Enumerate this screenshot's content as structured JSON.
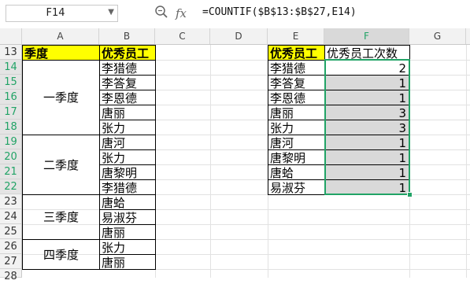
{
  "formula_bar": {
    "name_box": "F14",
    "zoom_icon": "zoom-icon",
    "fx_label": "fx",
    "formula": "=COUNTIF($B$13:$B$27,E14)"
  },
  "columns": [
    "A",
    "B",
    "C",
    "D",
    "E",
    "F",
    "G"
  ],
  "rows": [
    "13",
    "14",
    "15",
    "16",
    "17",
    "18",
    "19",
    "20",
    "21",
    "22",
    "23",
    "24",
    "25",
    "26",
    "27",
    "28"
  ],
  "table_left": {
    "header_quarter": "季度",
    "header_employee": "优秀员工",
    "quarters": [
      "一季度",
      "二季度",
      "三季度",
      "四季度"
    ],
    "employees": [
      "李猎德",
      "李答复",
      "李恩德",
      "唐丽",
      "张力",
      "唐河",
      "张力",
      "唐黎明",
      "李猎德",
      "唐蛤",
      "易淑芬",
      "唐丽",
      "张力",
      "唐丽"
    ]
  },
  "table_right": {
    "header_employee": "优秀员工",
    "header_count": "优秀员工次数",
    "names": [
      "李猎德",
      "李答复",
      "李恩德",
      "唐丽",
      "张力",
      "唐河",
      "唐黎明",
      "唐蛤",
      "易淑芬"
    ],
    "counts": [
      "2",
      "1",
      "1",
      "3",
      "3",
      "1",
      "1",
      "1",
      "1"
    ]
  },
  "colors": {
    "selection": "#21a366",
    "header_fill": "#ffff00",
    "selected_fill": "#d9d9d9"
  }
}
